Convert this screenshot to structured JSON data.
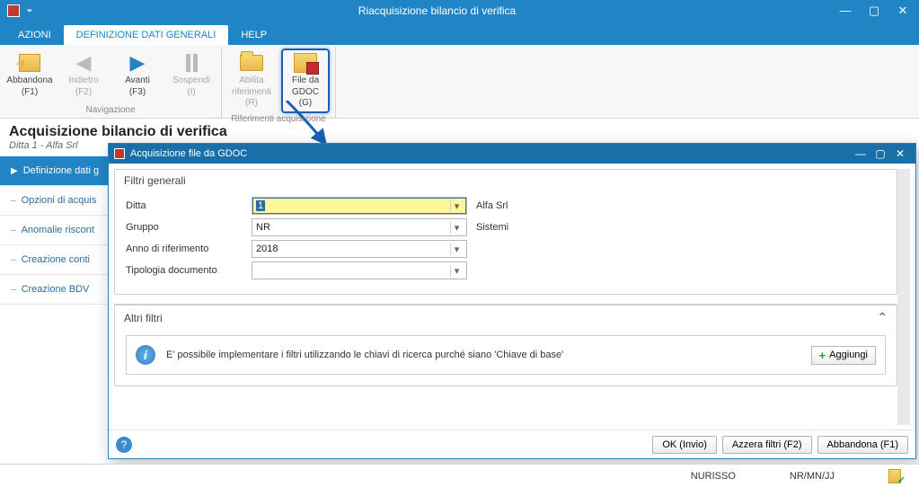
{
  "titlebar": {
    "title": "Riacquisizione bilancio di verifica"
  },
  "menu": {
    "azioni": "AZIONI",
    "definizione": "DEFINIZIONE DATI GENERALI",
    "help": "HELP"
  },
  "ribbon": {
    "nav_group": "Navigazione",
    "rif_group": "Riferimenti acquisizione",
    "abbandona": "Abbandona",
    "abbandona_sub": "(F1)",
    "indietro": "Indietro",
    "indietro_sub": "(F2)",
    "avanti": "Avanti",
    "avanti_sub": "(F3)",
    "sospendi": "Sospendi",
    "sospendi_sub": "(I)",
    "abilita": "Abilita",
    "abilita_sub": "riferimenti (R)",
    "fileda": "File da",
    "fileda_sub": "GDOC (G)"
  },
  "page": {
    "title": "Acquisizione bilancio di verifica",
    "subtitle": "Ditta 1 - Alfa Srl"
  },
  "sidenav": {
    "items": [
      {
        "label": "Definizione dati g",
        "active": true
      },
      {
        "label": "Opzioni di acquis"
      },
      {
        "label": "Anomalie riscont"
      },
      {
        "label": "Creazione conti"
      },
      {
        "label": "Creazione BDV"
      }
    ]
  },
  "dialog": {
    "title": "Acquisizione file da GDOC",
    "filtri_generali": "Filtri generali",
    "altri_filtri": "Altri filtri",
    "labels": {
      "ditta": "Ditta",
      "gruppo": "Gruppo",
      "anno": "Anno di riferimento",
      "tipologia": "Tipologia documento"
    },
    "values": {
      "ditta": "1",
      "ditta_after": "Alfa Srl",
      "gruppo": "NR",
      "gruppo_after": "Sistemi",
      "anno": "2018",
      "tipologia": ""
    },
    "info_text": "E' possibile implementare i filtri utilizzando le chiavi di ricerca purché siano 'Chiave di base'",
    "aggiungi": "Aggiungi",
    "buttons": {
      "ok": "OK (Invio)",
      "azzera": "Azzera filtri (F2)",
      "abbandona": "Abbandona (F1)"
    }
  },
  "statusbar": {
    "left": "NURISSO",
    "right": "NR/MN/JJ"
  }
}
